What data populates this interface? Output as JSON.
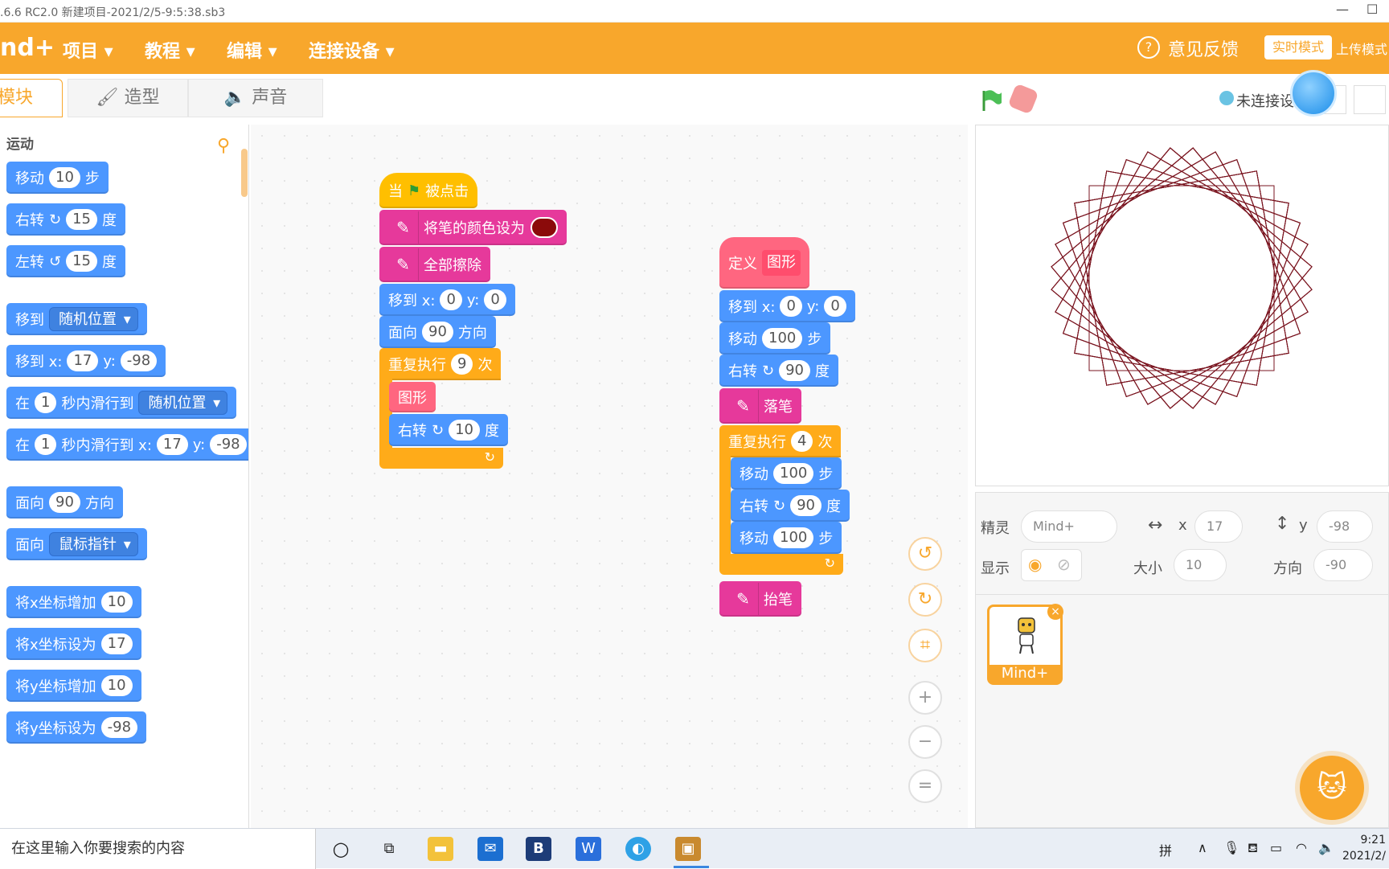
{
  "titlebar": {
    "title": ".6.6 RC2.0   新建项目-2021/2/5-9:5:38.sb3",
    "min": "—",
    "max": "☐"
  },
  "menubar": {
    "logo": "nd+",
    "items": [
      {
        "label": "项目 ▾"
      },
      {
        "label": "教程 ▾"
      },
      {
        "label": "编辑 ▾"
      },
      {
        "label": "连接设备 ▾"
      }
    ],
    "feedback_icon": "?",
    "feedback": "意见反馈",
    "realtime_mode": "实时模式",
    "upload_mode": "上传模式"
  },
  "tabs": {
    "blocks": "模块",
    "costumes": "造型",
    "sounds": "声音"
  },
  "stage_controls": {
    "connection": "未连接设"
  },
  "palette": {
    "category": "运动",
    "blocks": {
      "move": {
        "pre": "移动",
        "val": "10",
        "post": "步"
      },
      "turn_right": {
        "pre": "右转",
        "val": "15",
        "post": "度"
      },
      "turn_left": {
        "pre": "左转",
        "val": "15",
        "post": "度"
      },
      "goto": {
        "pre": "移到",
        "dd": "随机位置"
      },
      "goto_xy": {
        "pre": "移到 x:",
        "x": "17",
        "ymid": "y:",
        "y": "-98"
      },
      "glide_random": {
        "pre": "在",
        "secs": "1",
        "mid": "秒内滑行到",
        "dd": "随机位置"
      },
      "glide_xy": {
        "pre": "在",
        "secs": "1",
        "mid": "秒内滑行到 x:",
        "x": "17",
        "ymid": "y:",
        "y": "-98"
      },
      "point_dir": {
        "pre": "面向",
        "val": "90",
        "post": "方向"
      },
      "point_towards": {
        "pre": "面向",
        "dd": "鼠标指针"
      },
      "change_x": {
        "pre": "将x坐标增加",
        "val": "10"
      },
      "set_x": {
        "pre": "将x坐标设为",
        "val": "17"
      },
      "change_y": {
        "pre": "将y坐标增加",
        "val": "10"
      },
      "set_y": {
        "pre": "将y坐标设为",
        "val": "-98"
      }
    }
  },
  "script1": {
    "hat": {
      "pre": "当",
      "post": "被点击"
    },
    "set_pen_color": "将笔的颜色设为",
    "pen_color_value": "#8b0a0a",
    "clear": "全部擦除",
    "goto": {
      "pre": "移到 x:",
      "x": "0",
      "ymid": "y:",
      "y": "0"
    },
    "point": {
      "pre": "面向",
      "val": "90",
      "post": "方向"
    },
    "repeat": {
      "pre": "重复执行",
      "val": "9",
      "post": "次"
    },
    "call": "图形",
    "turn": {
      "pre": "右转",
      "val": "10",
      "post": "度"
    },
    "loop_arrow": "↻"
  },
  "script2": {
    "define": {
      "pre": "定义",
      "name": "图形"
    },
    "goto": {
      "pre": "移到 x:",
      "x": "0",
      "ymid": "y:",
      "y": "0"
    },
    "move": {
      "pre": "移动",
      "val": "100",
      "post": "步"
    },
    "turn": {
      "pre": "右转",
      "val": "90",
      "post": "度"
    },
    "pen_down": "落笔",
    "repeat": {
      "pre": "重复执行",
      "val": "4",
      "post": "次"
    },
    "inner_move1": {
      "pre": "移动",
      "val": "100",
      "post": "步"
    },
    "inner_turn": {
      "pre": "右转",
      "val": "90",
      "post": "度"
    },
    "inner_move2": {
      "pre": "移动",
      "val": "100",
      "post": "步"
    },
    "pen_up": "抬笔",
    "loop_arrow": "↻"
  },
  "zoom": {
    "undo": "↺",
    "redo": "↻",
    "crop": "⌗",
    "zoom_in": "+",
    "zoom_out": "−",
    "reset": "="
  },
  "sprite_info": {
    "sprite_label": "精灵",
    "sprite_name": "Mind+",
    "x_label": "x",
    "x": "17",
    "y_label": "y",
    "y": "-98",
    "show_label": "显示",
    "size_label": "大小",
    "size": "10",
    "direction_label": "方向",
    "direction": "-90"
  },
  "sprite_card": {
    "name": "Mind+",
    "delete": "×"
  },
  "stage_drawing": {
    "pen_color": "#7a1520",
    "square_count": 9,
    "square_side": 100,
    "rotation_step_deg": 10
  },
  "taskbar": {
    "search_placeholder": "在这里输入你要搜索的内容",
    "ime": "拼",
    "time": "9:21",
    "date": "2021/2/"
  }
}
